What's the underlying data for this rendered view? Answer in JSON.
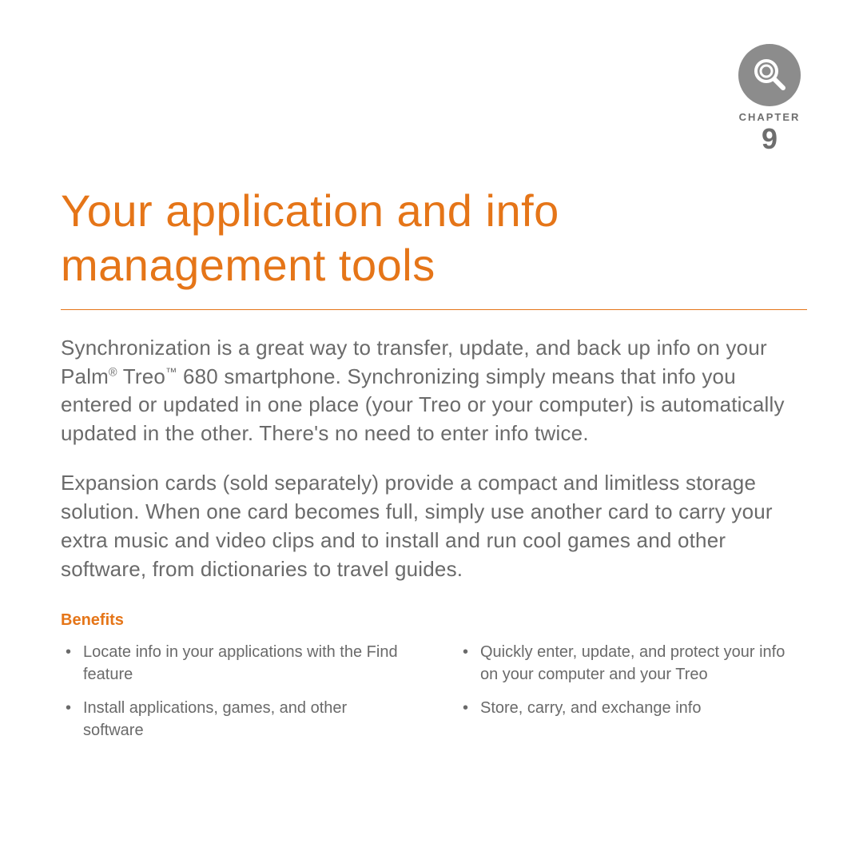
{
  "chapter": {
    "label": "CHAPTER",
    "number": "9"
  },
  "title": "Your application and info management tools",
  "intro": {
    "p1_pre": "Synchronization is a great way to transfer, update, and back up info on your Palm",
    "p1_mid": " Treo",
    "p1_post": " 680 smartphone. Synchronizing simply means that info you entered or updated in one place (your Treo or your computer) is automatically updated in the other. There's no need to enter info twice.",
    "p2": "Expansion cards (sold separately) provide a compact and limitless storage solution. When one card becomes full, simply use another card to carry your extra music and video clips and to install and run cool games and other software, from dictionaries to travel guides."
  },
  "benefits": {
    "heading": "Benefits",
    "left": [
      "Locate info in your applications with the Find feature",
      "Install applications, games, and other software"
    ],
    "right": [
      "Quickly enter, update, and protect your info on your computer and your Treo",
      "Store, carry, and exchange info"
    ]
  }
}
